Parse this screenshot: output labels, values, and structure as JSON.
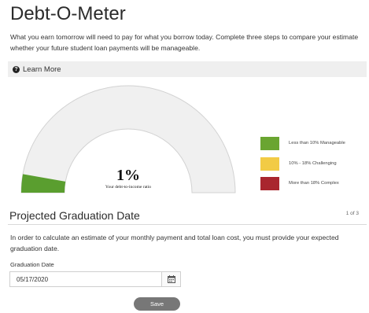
{
  "page": {
    "title": "Debt-O-Meter",
    "intro": "What you earn tomorrow will need to pay for what you borrow today. Complete three steps to compare your estimate whether your future student loan payments will be manageable."
  },
  "learn_more": {
    "label": "Learn More",
    "icon": "question-circle-icon"
  },
  "gauge": {
    "percent_label": "1%",
    "percent_value": 1,
    "caption": "Your debt-to-income ratio",
    "fill_color": "#5a9e2f",
    "track_color": "#f0f0f0"
  },
  "legend": {
    "items": [
      {
        "label": "Less than 10% Manageable",
        "color": "#6aa531"
      },
      {
        "label": "10% - 18% Challenging",
        "color": "#f2cb45"
      },
      {
        "label": "More than 18% Complex",
        "color": "#a9262e"
      }
    ]
  },
  "section": {
    "title": "Projected Graduation Date",
    "step": "1 of 3",
    "description": "In order to calculate an estimate of your monthly payment and total loan cost, you must provide your expected graduation date."
  },
  "form": {
    "graduation_label": "Graduation Date",
    "graduation_value": "05/17/2020",
    "calendar_icon": "calendar-icon",
    "save_label": "Save"
  }
}
